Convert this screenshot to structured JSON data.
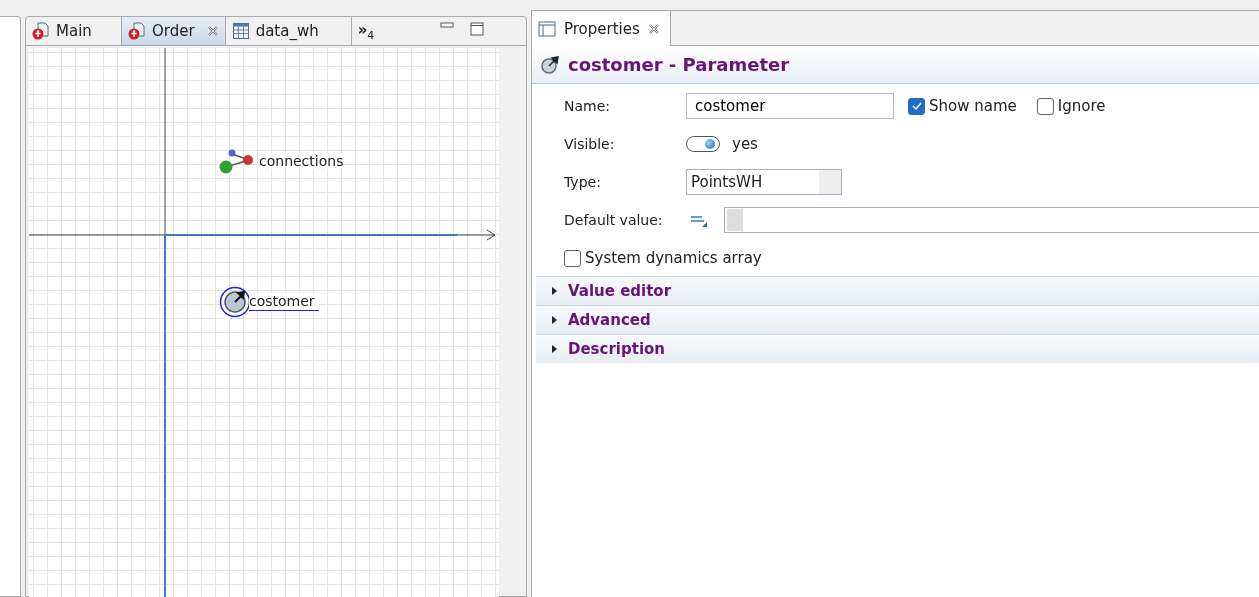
{
  "editor_tabs": [
    {
      "label": "Main",
      "kind": "agent",
      "selected": false,
      "closable": false
    },
    {
      "label": "Order",
      "kind": "agent",
      "selected": true,
      "closable": true
    },
    {
      "label": "data_wh",
      "kind": "table",
      "selected": false,
      "closable": false
    }
  ],
  "overflow": {
    "glyph": "»",
    "count": "4"
  },
  "canvas": {
    "items": [
      {
        "kind": "collection",
        "label": "connections",
        "selected": false
      },
      {
        "kind": "parameter",
        "label": "costomer",
        "selected": true
      }
    ]
  },
  "properties": {
    "tab": "Properties",
    "title": "costomer - Parameter",
    "name_label": "Name:",
    "name_value": "costomer",
    "show_name": {
      "label": "Show name",
      "checked": true
    },
    "ignore": {
      "label": "Ignore",
      "checked": false
    },
    "visible_label": "Visible:",
    "visible": {
      "on": true,
      "label": "yes"
    },
    "type_label": "Type:",
    "type_value": "PointsWH",
    "default_label": "Default value:",
    "sd_array": {
      "label": "System dynamics array",
      "checked": false
    },
    "sections": [
      {
        "label": "Value editor",
        "expanded": false
      },
      {
        "label": "Advanced",
        "expanded": false
      },
      {
        "label": "Description",
        "expanded": false
      }
    ]
  }
}
